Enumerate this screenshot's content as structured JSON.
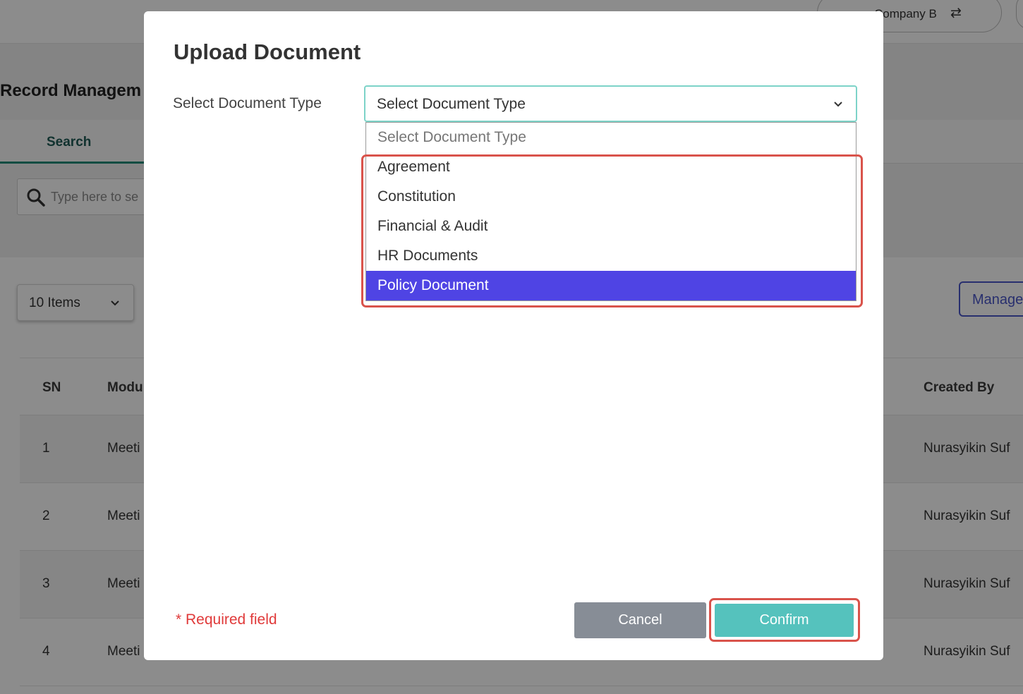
{
  "header": {
    "company_label": "Company B",
    "switch_icon": "swap-arrows-icon"
  },
  "page": {
    "title": "Record Managem",
    "tab_search": "Search",
    "search_placeholder": "Type here to se",
    "items_per_page": "10 Items",
    "manage_label": "Manage"
  },
  "table": {
    "columns": [
      "SN",
      "Modu",
      "Created By"
    ],
    "rows": [
      {
        "sn": "1",
        "module": "Meeti",
        "created_by": "Nurasyikin Suf"
      },
      {
        "sn": "2",
        "module": "Meeti",
        "created_by": "Nurasyikin Suf"
      },
      {
        "sn": "3",
        "module": "Meeti",
        "created_by": "Nurasyikin Suf"
      },
      {
        "sn": "4",
        "module": "Meeti",
        "created_by": "Nurasyikin Suf"
      }
    ]
  },
  "modal": {
    "title": "Upload Document",
    "field_label": "Select Document Type",
    "select_value": "Select Document Type",
    "options": [
      "Select Document Type",
      "Agreement",
      "Constitution",
      "Financial & Audit",
      "HR Documents",
      "Policy Document"
    ],
    "selected_option": "Policy Document",
    "required_note": "* Required field",
    "cancel_label": "Cancel",
    "confirm_label": "Confirm"
  },
  "colors": {
    "accent_teal": "#55c2bd",
    "selected_option_bg": "#4f44e4",
    "highlight_red": "#d9534b",
    "required_red": "#e03a3a",
    "cancel_gray": "#878d96"
  }
}
